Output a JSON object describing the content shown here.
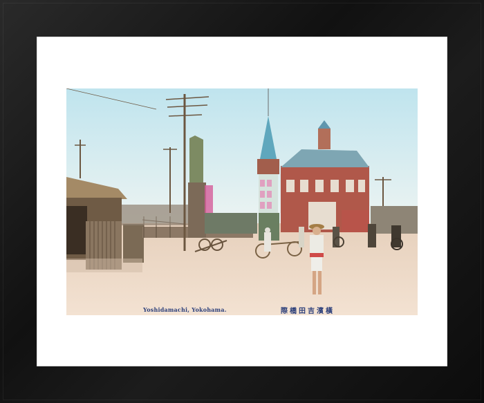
{
  "photo": {
    "caption_english": "Yoshidamachi, Yokohama.",
    "caption_japanese": "際橋田吉濱橫"
  },
  "colors": {
    "frame": "#151515",
    "mat": "#ffffff",
    "sky": "#c9e6ef",
    "ground": "#f0dcc8",
    "caption": "#2c3f7a"
  }
}
